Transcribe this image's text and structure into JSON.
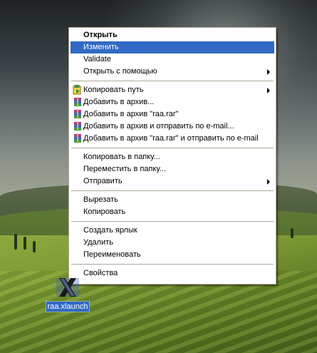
{
  "menu": {
    "items": [
      {
        "label": "Открыть",
        "bold": true
      },
      {
        "label": "Изменить",
        "selected": true
      },
      {
        "label": "Validate"
      },
      {
        "label": "Открыть с помощью",
        "submenu": true
      },
      {
        "label": "Копировать путь",
        "submenu": true,
        "icon": "copy-path-icon"
      },
      {
        "label": "Добавить в архив...",
        "icon": "winrar-icon"
      },
      {
        "label": "Добавить в архив \"raa.rar\"",
        "icon": "winrar-icon"
      },
      {
        "label": "Добавить в архив и отправить по e-mail...",
        "icon": "winrar-icon"
      },
      {
        "label": "Добавить в архив \"raa.rar\" и отправить по e-mail",
        "icon": "winrar-icon"
      },
      {
        "label": "Копировать в папку..."
      },
      {
        "label": "Переместить в папку..."
      },
      {
        "label": "Отправить",
        "submenu": true
      },
      {
        "label": "Вырезать"
      },
      {
        "label": "Копировать"
      },
      {
        "label": "Создать ярлык"
      },
      {
        "label": "Удалить"
      },
      {
        "label": "Переименовать"
      },
      {
        "label": "Свойства"
      }
    ]
  },
  "desktop": {
    "file_icon": "xlaunch-icon",
    "file_label": "raa.xlaunch"
  },
  "colors": {
    "selection": "#316ac5",
    "menu_border": "#aca899"
  }
}
